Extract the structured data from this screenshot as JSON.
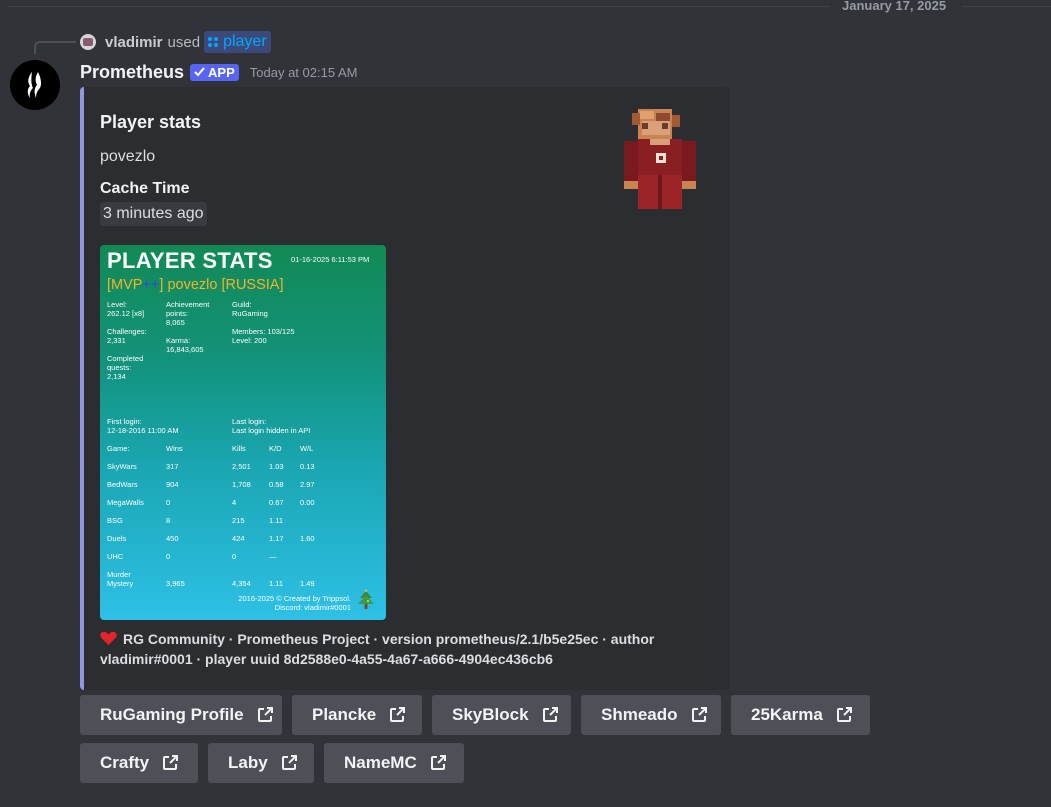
{
  "date_divider": "January 17, 2025",
  "reply": {
    "user": "vladimir",
    "verb": "used",
    "command": "player"
  },
  "message": {
    "author": "Prometheus",
    "badge": "APP",
    "timestamp": "Today at 02:15 AM"
  },
  "embed": {
    "accent_color": "#8f96e3",
    "title": "Player stats",
    "description": "povezlo",
    "field_name": "Cache Time",
    "field_value": "3 minutes ago",
    "footer_text": "RG Community · Prometheus Project · version prometheus/2.1/b5e25ec · author vladimir#0001 · player uuid 8d2588e0-4a55-4a67-a666-4904ec436cb6",
    "footer_icon": "heart-icon"
  },
  "stats_image": {
    "title": "PLAYER STATS",
    "timestamp": "01-16-2025 6:11:53 PM",
    "rank_open": "[MVP",
    "rank_plus": "++",
    "rank_close": "] povezlo [RUSSIA]",
    "level": "Level:\n262.12 [x8]",
    "achievement": "Achievement\npoints:\n8,065",
    "guild": "Guild:\nRuGaming",
    "challenges": "Challenges:\n2,331",
    "karma": "Karma:\n16,843,605",
    "members": "Members: 103/125\nLevel: 200",
    "completed": "Completed\nquests:\n2,134",
    "first_login": "First login:\n12-18-2016 11:00 AM",
    "last_login": "Last login:\nLast login hidden in API",
    "headers": [
      "Game:",
      "Wins",
      "Kills",
      "K/D",
      "W/L"
    ],
    "rows": [
      [
        "SkyWars",
        "317",
        "2,501",
        "1.03",
        "0.13"
      ],
      [
        "BedWars",
        "904",
        "1,708",
        "0.58",
        "2.97"
      ],
      [
        "MegaWalls",
        "0",
        "4",
        "0.67",
        "0.00"
      ],
      [
        "BSG",
        "8",
        "215",
        "1.11",
        ""
      ],
      [
        "Duels",
        "450",
        "424",
        "1.17",
        "1.60"
      ],
      [
        "UHC",
        "0",
        "0",
        "—",
        ""
      ],
      [
        "Murder\nMystery",
        "3,965",
        "4,354",
        "1.11",
        "1.49"
      ]
    ],
    "footer": "2016-2025 © Created by Trippsol.\nDiscord: vladimir#0001"
  },
  "buttons": [
    {
      "label": "RuGaming Profile",
      "icon": "external-link-icon"
    },
    {
      "label": "Plancke",
      "icon": "external-link-icon"
    },
    {
      "label": "SkyBlock",
      "icon": "external-link-icon"
    },
    {
      "label": "Shmeado",
      "icon": "external-link-icon"
    },
    {
      "label": "25Karma",
      "icon": "external-link-icon"
    },
    {
      "label": "Crafty",
      "icon": "external-link-icon"
    },
    {
      "label": "Laby",
      "icon": "external-link-icon"
    },
    {
      "label": "NameMC",
      "icon": "external-link-icon"
    }
  ]
}
